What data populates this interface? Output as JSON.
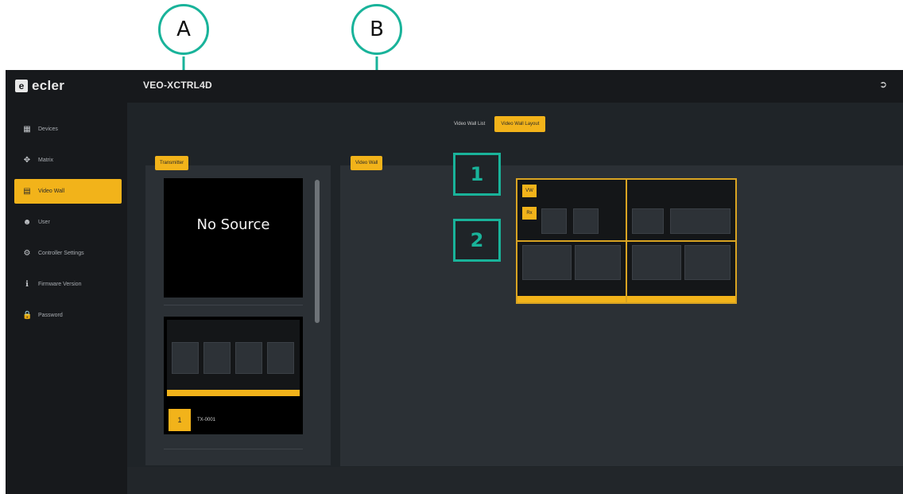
{
  "callouts": {
    "a": "A",
    "b": "B",
    "one": "1",
    "two": "2"
  },
  "sidebar": {
    "logo": "ecler",
    "items": [
      {
        "label": "Devices",
        "icon": "grid-icon"
      },
      {
        "label": "Matrix",
        "icon": "move-icon"
      },
      {
        "label": "Video Wall",
        "icon": "video-wall-icon",
        "active": true
      },
      {
        "label": "User",
        "icon": "user-icon"
      },
      {
        "label": "Controller Settings",
        "icon": "gear-icon"
      },
      {
        "label": "Firmware Version",
        "icon": "info-icon"
      },
      {
        "label": "Password",
        "icon": "lock-icon"
      }
    ]
  },
  "header": {
    "title": "VEO-XCTRL4D"
  },
  "tabs": [
    {
      "label": "Video Wall List",
      "active": false
    },
    {
      "label": "Video Wall Layout",
      "active": true
    }
  ],
  "left_panel": {
    "button": "Transmitter",
    "sources": [
      {
        "label": "No Source"
      },
      {
        "number": "1",
        "name": "TX-0001"
      }
    ]
  },
  "right_panel": {
    "button": "Video Wall",
    "badges": [
      "VW",
      "Rx"
    ]
  },
  "colors": {
    "accent": "#f2b31a",
    "callout": "#19b39a",
    "background": "#1f2428"
  }
}
